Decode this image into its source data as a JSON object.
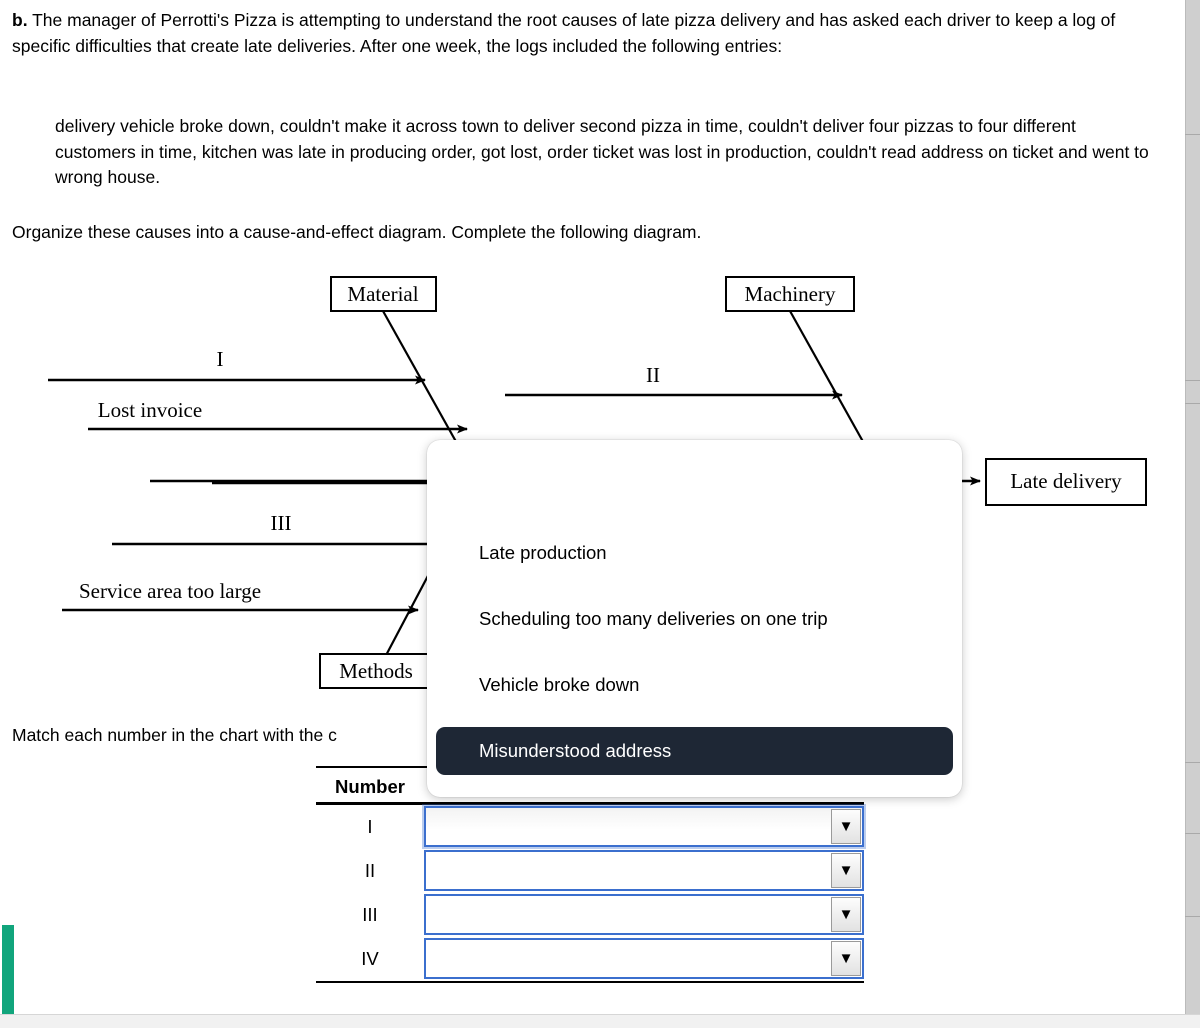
{
  "question": {
    "label": "b.",
    "intro": " The manager of Perrotti's Pizza is attempting to understand the root causes of late pizza delivery and has asked each driver to keep a log of specific difficulties that create late deliveries. After one week, the logs included the following entries:",
    "log_entries": "delivery vehicle broke down, couldn't make it across town to deliver second pizza in time, couldn't deliver four pizzas to four different customers in time, kitchen was late in producing order, got lost, order ticket was lost in production, couldn't read address on ticket and went to wrong house.",
    "organize_instruction": "Organize these causes into a cause-and-effect diagram. Complete the following diagram.",
    "match_instruction": "Match each number in the chart with the c"
  },
  "diagram": {
    "categories": [
      {
        "id": "material",
        "label": "Material"
      },
      {
        "id": "machinery",
        "label": "Machinery"
      },
      {
        "id": "methods",
        "label": "Methods"
      }
    ],
    "effect_box": "Late delivery",
    "bone_labels": [
      {
        "id": "bone-1",
        "label": "I"
      },
      {
        "id": "bone-2",
        "label": "Lost invoice"
      },
      {
        "id": "bone-3",
        "label": "II"
      },
      {
        "id": "bone-4",
        "label": "III"
      },
      {
        "id": "bone-5",
        "label": "Service area too large"
      }
    ]
  },
  "dropdown": {
    "options": [
      {
        "label": "Late production",
        "selected": false
      },
      {
        "label": "Scheduling too many deliveries on one trip",
        "selected": false
      },
      {
        "label": "Vehicle broke down",
        "selected": false
      },
      {
        "label": "Misunderstood address",
        "selected": true
      }
    ],
    "highlight_color": "#1e2735"
  },
  "answer_table": {
    "header_number": "Number",
    "rows": [
      {
        "number": "I",
        "value": "",
        "focused": true,
        "arrow": "▼"
      },
      {
        "number": "II",
        "value": "",
        "focused": false,
        "arrow": "▼"
      },
      {
        "number": "III",
        "value": "",
        "focused": false,
        "arrow": "▼"
      },
      {
        "number": "IV",
        "value": "",
        "focused": false,
        "arrow": "▼"
      }
    ]
  },
  "scrollbar": {
    "thumb_color": "#11a57c",
    "track_color": "#cfcfcf"
  }
}
